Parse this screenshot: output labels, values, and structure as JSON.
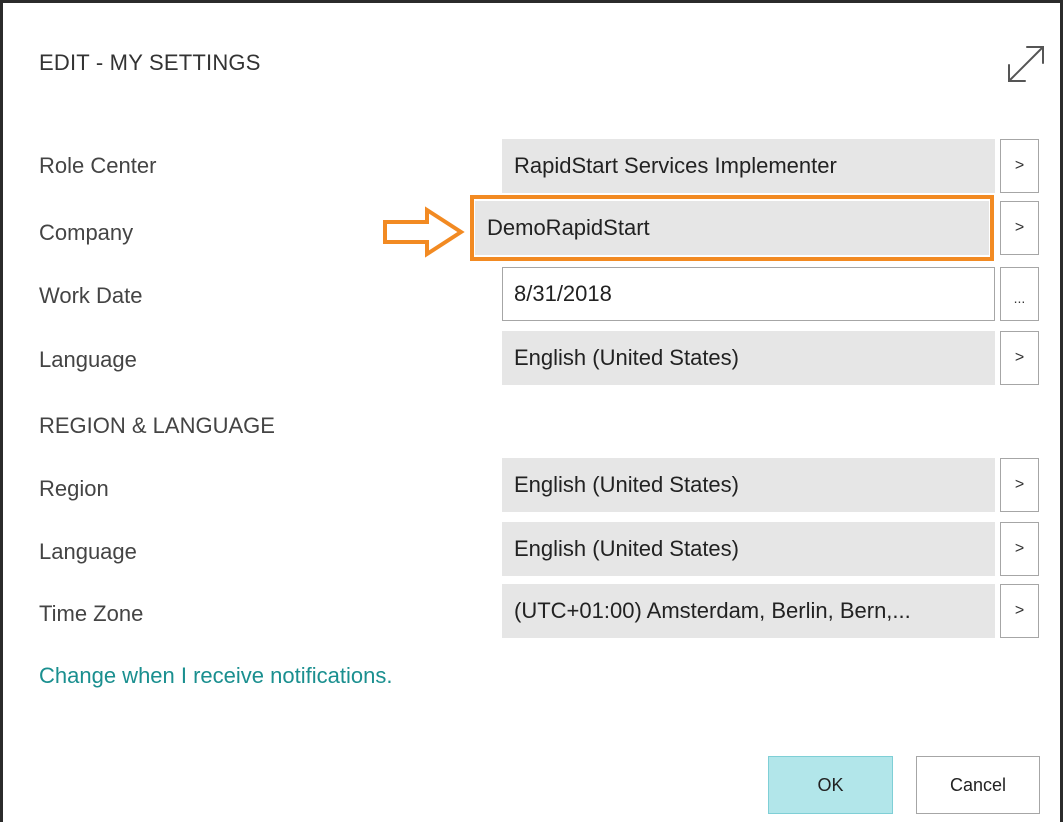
{
  "dialog": {
    "title": "EDIT - MY SETTINGS",
    "expand_icon": "expand-diagonal-arrows-icon"
  },
  "fields": {
    "role_center": {
      "label": "Role Center",
      "value": "RapidStart Services Implementer",
      "button": ">"
    },
    "company": {
      "label": "Company",
      "value": "DemoRapidStart",
      "button": ">"
    },
    "work_date": {
      "label": "Work Date",
      "value": "8/31/2018",
      "button": "..."
    },
    "language": {
      "label": "Language",
      "value": "English (United States)",
      "button": ">"
    }
  },
  "region_section": {
    "title": "REGION & LANGUAGE",
    "region": {
      "label": "Region",
      "value": "English (United States)",
      "button": ">"
    },
    "language": {
      "label": "Language",
      "value": "English (United States)",
      "button": ">"
    },
    "time_zone": {
      "label": "Time Zone",
      "value": "(UTC+01:00) Amsterdam, Berlin, Bern,...",
      "button": ">"
    }
  },
  "notifications_link": "Change when I receive notifications.",
  "actions": {
    "ok": "OK",
    "cancel": "Cancel"
  },
  "annotation": {
    "color": "#f28a22",
    "arrow_icon": "outline-arrow-right-icon"
  },
  "colors": {
    "link": "#1a8f8f",
    "ok_button": "#b2e6ea",
    "field_background": "#e6e6e6"
  }
}
